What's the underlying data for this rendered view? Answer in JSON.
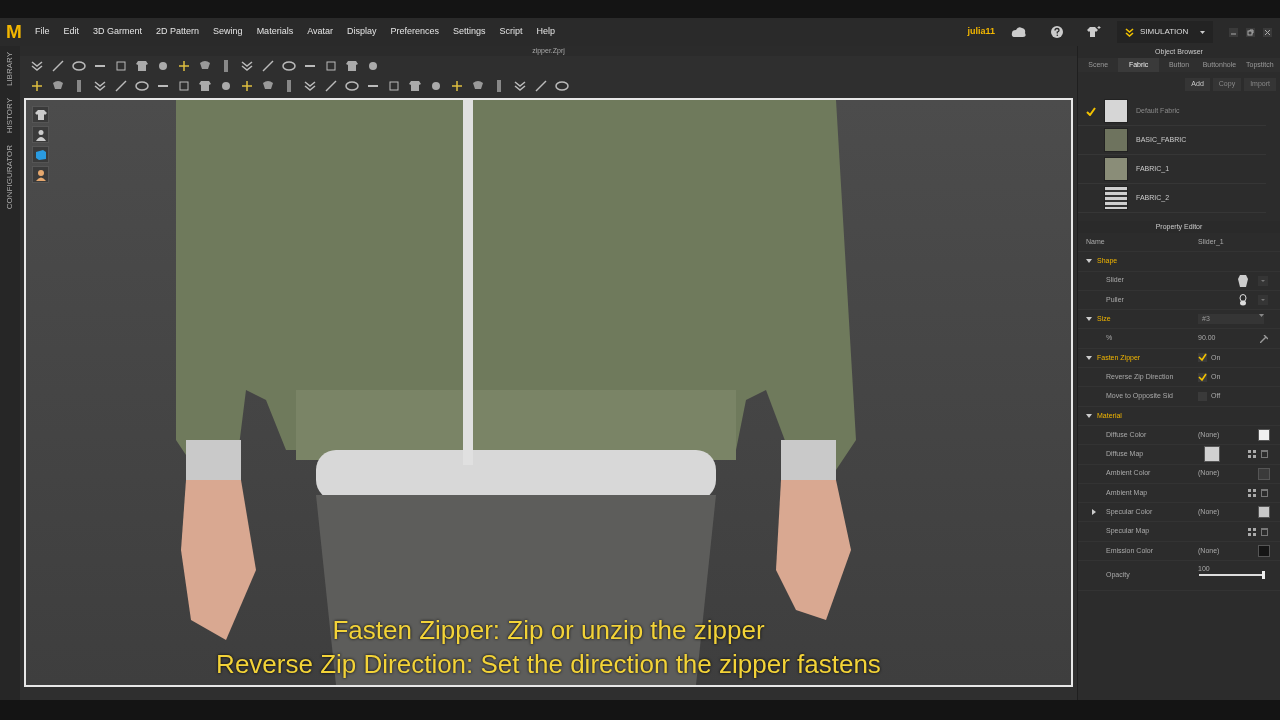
{
  "app_logo": "M",
  "menu": [
    "File",
    "Edit",
    "3D Garment",
    "2D Pattern",
    "Sewing",
    "Materials",
    "Avatar",
    "Display",
    "Preferences",
    "Settings",
    "Script",
    "Help"
  ],
  "user": "julia11",
  "mode": "SIMULATION",
  "document_title": "zipper.Zprj",
  "side_tabs": [
    "LIBRARY",
    "HISTORY",
    "CONFIGURATOR"
  ],
  "subtitles": [
    "Fasten Zipper: Zip or unzip the zipper",
    "Reverse Zip Direction: Set the direction the zipper fastens"
  ],
  "object_browser": {
    "title": "Object Browser",
    "tabs": [
      {
        "label": "Scene",
        "selected": false
      },
      {
        "label": "Fabric",
        "selected": true
      },
      {
        "label": "Button",
        "selected": false
      },
      {
        "label": "Buttonhole",
        "selected": false
      },
      {
        "label": "Topstitch",
        "selected": false
      }
    ],
    "actions": [
      {
        "label": "Add",
        "disabled": false
      },
      {
        "label": "Copy",
        "disabled": true
      },
      {
        "label": "Import",
        "disabled": true
      }
    ],
    "fabrics": [
      {
        "name": "Default Fabric",
        "selected": true,
        "kind": "solid",
        "color": "#d6d6d6"
      },
      {
        "name": "BASIC_FABRIC",
        "selected": false,
        "kind": "solid",
        "color": "#6e735e"
      },
      {
        "name": "FABRIC_1",
        "selected": false,
        "kind": "solid",
        "color": "#8a8d78"
      },
      {
        "name": "FABRIC_2",
        "selected": false,
        "kind": "pattern",
        "color": "#cfcfcf"
      }
    ]
  },
  "property_editor": {
    "title": "Property Editor",
    "name_label": "Name",
    "name_value": "Slider_1",
    "sections": [
      {
        "title": "Shape",
        "kind": "plain",
        "expanded": true,
        "rows": [
          {
            "kind": "shape",
            "label": "Slider"
          },
          {
            "kind": "shape",
            "label": "Puller"
          }
        ]
      },
      {
        "title": "Size",
        "kind": "dropdown",
        "value": "#3",
        "expanded": true,
        "rows": [
          {
            "kind": "number",
            "label": "%",
            "value": "90.00"
          }
        ]
      },
      {
        "title": "Fasten Zipper",
        "kind": "check",
        "checked": true,
        "value": "On",
        "expanded": true,
        "rows": [
          {
            "kind": "check",
            "label": "Reverse Zip Direction",
            "checked": true,
            "value": "On"
          },
          {
            "kind": "check",
            "label": "Move to Opposite Sid",
            "checked": false,
            "value": "Off"
          }
        ]
      },
      {
        "title": "Material",
        "kind": "plain",
        "expanded": true,
        "rows": [
          {
            "kind": "color",
            "label": "Diffuse Color",
            "value": "(None)",
            "color": "#f0f0f0"
          },
          {
            "kind": "map",
            "label": "Diffuse Map",
            "thumbnail": true
          },
          {
            "kind": "color",
            "label": "Ambient Color",
            "value": "(None)",
            "color": "#3a3a3a"
          },
          {
            "kind": "map",
            "label": "Ambient Map",
            "thumbnail": false
          },
          {
            "kind": "color-group",
            "label": "Specular Color",
            "value": "(None)",
            "color": "#c8c8c8"
          },
          {
            "kind": "map",
            "label": "Specular Map",
            "thumbnail": false
          },
          {
            "kind": "color",
            "label": "Emission Color",
            "value": "(None)",
            "color": "#151515"
          },
          {
            "kind": "slider",
            "label": "Opacity",
            "value": "100",
            "level": 1
          }
        ]
      }
    ]
  }
}
